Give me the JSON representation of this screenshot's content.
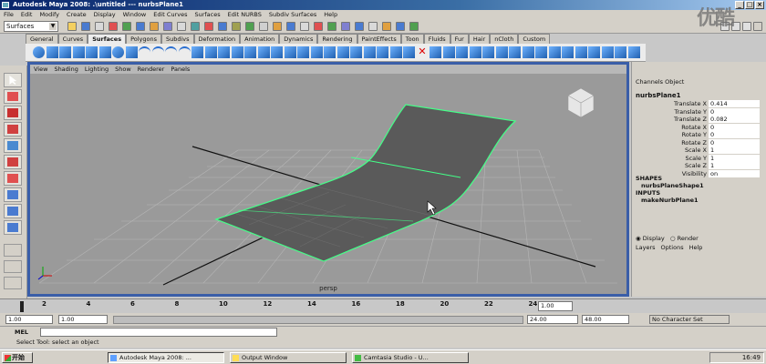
{
  "window": {
    "title": "Autodesk Maya 2008: .\\untitled --- nurbsPlane1"
  },
  "menubar": [
    "File",
    "Edit",
    "Modify",
    "Create",
    "Display",
    "Window",
    "Edit Curves",
    "Surfaces",
    "Edit NURBS",
    "Subdiv Surfaces",
    "Help"
  ],
  "status_line": {
    "mode": "Surfaces"
  },
  "shelf": {
    "tabs": [
      "General",
      "Curves",
      "Surfaces",
      "Polygons",
      "Subdivs",
      "Deformation",
      "Animation",
      "Dynamics",
      "Rendering",
      "PaintEffects",
      "Toon",
      "Fluids",
      "Fur",
      "Hair",
      "nCloth",
      "Custom"
    ],
    "active_tab": "Surfaces"
  },
  "viewport": {
    "menu": [
      "View",
      "Shading",
      "Lighting",
      "Show",
      "Renderer",
      "Panels"
    ],
    "camera_label": "persp",
    "colors": {
      "background": "#9a9a9a",
      "surface": "#5c5c5c",
      "highlight": "#44ff88"
    }
  },
  "channel_box": {
    "tabs": [
      "Channels",
      "Object"
    ],
    "object_name": "nurbsPlane1",
    "attributes": [
      {
        "label": "Translate X",
        "value": "0.414"
      },
      {
        "label": "Translate Y",
        "value": "0"
      },
      {
        "label": "Translate Z",
        "value": "0.082"
      },
      {
        "label": "Rotate X",
        "value": "0"
      },
      {
        "label": "Rotate Y",
        "value": "0"
      },
      {
        "label": "Rotate Z",
        "value": "0"
      },
      {
        "label": "Scale X",
        "value": "1"
      },
      {
        "label": "Scale Y",
        "value": "1"
      },
      {
        "label": "Scale Z",
        "value": "1"
      },
      {
        "label": "Visibility",
        "value": "on"
      }
    ],
    "shapes_header": "SHAPES",
    "shape_name": "nurbsPlaneShape1",
    "inputs_header": "INPUTS",
    "input_name": "makeNurbPlane1",
    "layer_mode": {
      "display": "Display",
      "render": "Render",
      "selected": "Display"
    },
    "layer_menu": [
      "Layers",
      "Options",
      "Help"
    ]
  },
  "time_slider": {
    "ticks": [
      "2",
      "4",
      "6",
      "8",
      "10",
      "12",
      "14",
      "16",
      "18",
      "20",
      "22",
      "24"
    ],
    "current_frame": "1.00"
  },
  "range_slider": {
    "start": "1.00",
    "inner_start": "1.00",
    "end_fields": [
      "24.00",
      "48.00"
    ],
    "character_set": "No Character Set"
  },
  "command_line": {
    "label": "MEL"
  },
  "help_line": {
    "text": "Select Tool: select an object"
  },
  "taskbar": {
    "start_label": "开始",
    "tasks": [
      "Autodesk Maya 2008: ...",
      "Output Window",
      "Camtasia Studio - U..."
    ],
    "clock": "16:49"
  },
  "watermark": "优酷"
}
